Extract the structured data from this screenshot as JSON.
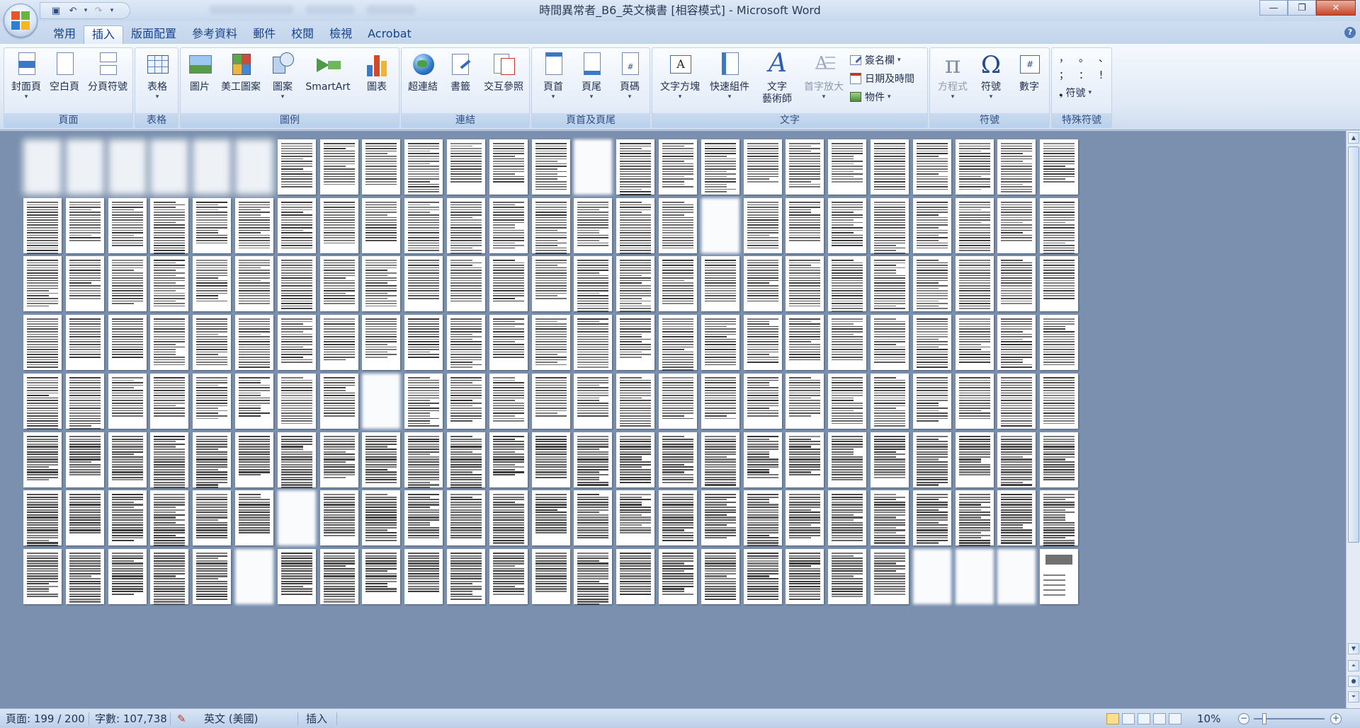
{
  "window": {
    "title": "時間異常者_B6_英文橫書 [相容模式] - Microsoft Word",
    "controls": {
      "minimize": "—",
      "maximize": "❐",
      "close": "✕"
    }
  },
  "quick_access": {
    "save_icon": "save-icon",
    "undo": "↶",
    "undo_dropdown": "▾",
    "redo": "↷",
    "customize": "▾"
  },
  "tabs": [
    {
      "label": "常用",
      "active": false
    },
    {
      "label": "插入",
      "active": true
    },
    {
      "label": "版面配置",
      "active": false
    },
    {
      "label": "參考資料",
      "active": false
    },
    {
      "label": "郵件",
      "active": false
    },
    {
      "label": "校閱",
      "active": false
    },
    {
      "label": "檢視",
      "active": false
    },
    {
      "label": "Acrobat",
      "active": false
    }
  ],
  "help_label": "?",
  "ribbon": {
    "pages": {
      "label": "頁面",
      "cover": "封面頁",
      "blank": "空白頁",
      "break": "分頁符號"
    },
    "tables": {
      "label": "表格",
      "table": "表格"
    },
    "illustrations": {
      "label": "圖例",
      "picture": "圖片",
      "clipart": "美工圖案",
      "shapes": "圖案",
      "smartart": "SmartArt",
      "chart": "圖表"
    },
    "links": {
      "label": "連結",
      "hyperlink": "超連結",
      "bookmark": "書籤",
      "crossref": "交互參照"
    },
    "header_footer": {
      "label": "頁首及頁尾",
      "header": "頁首",
      "footer": "頁尾",
      "page_number": "頁碼"
    },
    "text": {
      "label": "文字",
      "textbox": "文字方塊",
      "quickparts": "快速組件",
      "wordart_line1": "文字",
      "wordart_line2": "藝術師",
      "dropcap": "首字放大",
      "signature": "簽名欄",
      "datetime": "日期及時間",
      "object": "物件"
    },
    "symbols": {
      "label": "符號",
      "equation": "方程式",
      "symbol": "符號",
      "number": "數字",
      "pi": "π",
      "omega": "Ω",
      "hash": "#"
    },
    "special": {
      "label": "特殊符號",
      "symbol": "符號",
      "row1": [
        "，",
        "。",
        "、"
      ],
      "row2": [
        "；",
        "：",
        "！"
      ],
      "lead": "❟"
    },
    "dropdown_arrow": "▾"
  },
  "status": {
    "page": "頁面: 199 / 200",
    "words": "字數: 107,738",
    "language": "英文 (美國)",
    "mode": "插入",
    "zoom": "10%",
    "zoom_minus": "−",
    "zoom_plus": "+"
  },
  "colors": {
    "accent": "#15428b",
    "ribbon": "#dfe9f6",
    "doc_bg": "#7a90ae"
  }
}
